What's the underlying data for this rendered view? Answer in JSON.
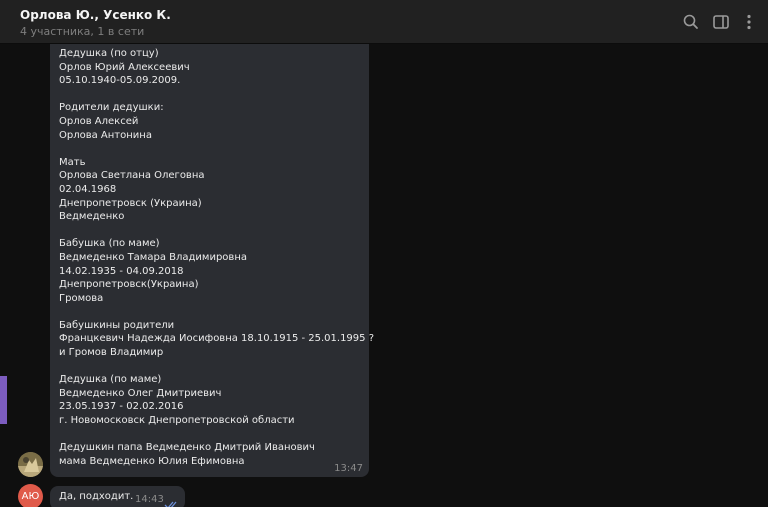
{
  "header": {
    "title": "Орлова Ю., Усенко К.",
    "subtitle": "4 участника, 1 в сети",
    "icons": [
      "search-icon",
      "sidebar-toggle-icon",
      "more-vertical-icon"
    ]
  },
  "messages": [
    {
      "sender_avatar": "photo",
      "time": "13:47",
      "lines": [
        "Дедушка (по отцу)",
        "Орлов Юрий Алексеевич",
        "05.10.1940-05.09.2009.",
        "",
        "Родители дедушки:",
        "Орлов Алексей",
        "Орлова Антонина",
        "",
        "Мать",
        "Орлова Светлана Олеговна",
        "02.04.1968",
        "Днепропетровск (Украина)",
        "Ведмеденко",
        "",
        "Бабушка (по маме)",
        "Ведмеденко Тамара Владимировна",
        "14.02.1935 - 04.09.2018",
        "Днепропетровск(Украина)",
        "Громова",
        "",
        "Бабушкины родители",
        "Францкевич Надежда Иосифовна 18.10.1915 - 25.01.1995 ?",
        "и Громов Владимир",
        "",
        "Дедушка (по маме)",
        "Ведмеденко Олег Дмитриевич",
        "23.05.1937 - 02.02.2016",
        "г. Новомосковск Днепропетровской области",
        "",
        "Дедушкин папа Ведмеденко Дмитрий Иванович",
        "мама Ведмеденко Юлия Ефимовна"
      ]
    },
    {
      "sender_avatar_initials": "АЮ",
      "text": "Да, подходит.",
      "time": "14:43",
      "status": "read"
    }
  ],
  "colors": {
    "header_bg": "#212121",
    "history_bg": "#0f0f0f",
    "bubble_bg": "#2b2d32",
    "accent_strip": "#7c5cbf",
    "avatar_initials_bg": "#e05a4a",
    "read_check": "#6c8fd8"
  }
}
